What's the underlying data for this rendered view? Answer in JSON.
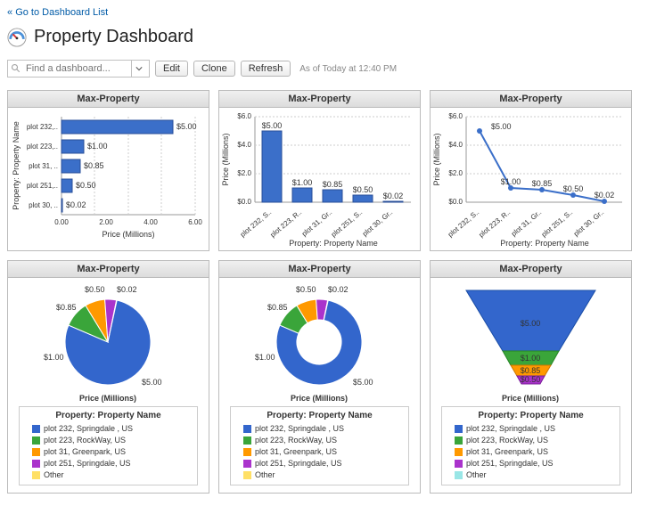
{
  "nav": {
    "back_label": "Go to Dashboard List",
    "back_prefix": "« "
  },
  "page": {
    "title": "Property Dashboard"
  },
  "toolbar": {
    "search_placeholder": "Find a dashboard...",
    "edit": "Edit",
    "clone": "Clone",
    "refresh": "Refresh",
    "timestamp": "As of Today at 12:40 PM"
  },
  "panels": {
    "title": "Max-Property",
    "xlabel_price": "Price (Millions)",
    "xlabel_prop": "Property: Property Name",
    "legend_subtitle": "Property: Property Name"
  },
  "legend": {
    "items": [
      {
        "label": "plot 232, Springdale , US",
        "color": "#3366cc"
      },
      {
        "label": "plot 223, RockWay, US",
        "color": "#3aa53a"
      },
      {
        "label": "plot 31, Greenpark, US",
        "color": "#ff9900"
      },
      {
        "label": "plot 251, Springdale, US",
        "color": "#aa33cc"
      },
      {
        "label": "Other",
        "color": "#ffe066"
      }
    ]
  },
  "funnel_legend": {
    "items": [
      {
        "label": "plot 232, Springdale , US",
        "color": "#3366cc"
      },
      {
        "label": "plot 223, RockWay, US",
        "color": "#3aa53a"
      },
      {
        "label": "plot 31, Greenpark, US",
        "color": "#ff9900"
      },
      {
        "label": "plot 251, Springdale, US",
        "color": "#aa33cc"
      },
      {
        "label": "Other",
        "color": "#99e6e6"
      }
    ]
  },
  "chart_data": [
    {
      "type": "bar",
      "orientation": "horizontal",
      "title": "Max-Property",
      "xlabel": "Price (Millions)",
      "ylabel": "Property: Property Name",
      "categories": [
        "plot 232,..",
        "plot 223,..",
        "plot 31, ..",
        "plot 251,..",
        "plot 30, .."
      ],
      "values": [
        5.0,
        1.0,
        0.85,
        0.5,
        0.02
      ],
      "value_labels": [
        "$5.00",
        "$1.00",
        "$0.85",
        "$0.50",
        "$0.02"
      ],
      "xlim": [
        0.0,
        6.0
      ],
      "xticks": [
        0.0,
        2.0,
        4.0,
        6.0
      ]
    },
    {
      "type": "bar",
      "orientation": "vertical",
      "title": "Max-Property",
      "xlabel": "Property: Property Name",
      "ylabel": "Price (Millions)",
      "categories": [
        "plot 232, S..",
        "plot 223, R..",
        "plot 31, Gr..",
        "plot 251, S..",
        "plot 30, Gr.."
      ],
      "values": [
        5.0,
        1.0,
        0.85,
        0.5,
        0.02
      ],
      "value_labels": [
        "$5.00",
        "$1.00",
        "$0.85",
        "$0.50",
        "$0.02"
      ],
      "ylim": [
        0.0,
        6.0
      ],
      "yticks": [
        "$0.0",
        "$2.0",
        "$4.0",
        "$6.0"
      ]
    },
    {
      "type": "line",
      "title": "Max-Property",
      "xlabel": "Property: Property Name",
      "ylabel": "Price (Millions)",
      "categories": [
        "plot 232, S..",
        "plot 223, R..",
        "plot 31, Gr..",
        "plot 251, S..",
        "plot 30, Gr.."
      ],
      "values": [
        5.0,
        1.0,
        0.85,
        0.5,
        0.02
      ],
      "value_labels": [
        "$5.00",
        "$1.00",
        "$0.85",
        "$0.50",
        "$0.02"
      ],
      "ylim": [
        0.0,
        6.0
      ],
      "yticks": [
        "$0.0",
        "$2.0",
        "$4.0",
        "$6.0"
      ]
    },
    {
      "type": "pie",
      "title": "Max-Property",
      "slices": [
        {
          "label": "$5.00",
          "value": 5.0,
          "color": "#3366cc"
        },
        {
          "label": "$1.00",
          "value": 1.0,
          "color": "#3aa53a"
        },
        {
          "label": "$0.85",
          "value": 0.85,
          "color": "#ff9900"
        },
        {
          "label": "$0.50",
          "value": 0.5,
          "color": "#aa33cc"
        },
        {
          "label": "$0.02",
          "value": 0.02,
          "color": "#ffe066"
        }
      ]
    },
    {
      "type": "pie",
      "donut": true,
      "title": "Max-Property",
      "slices": [
        {
          "label": "$5.00",
          "value": 5.0,
          "color": "#3366cc"
        },
        {
          "label": "$1.00",
          "value": 1.0,
          "color": "#3aa53a"
        },
        {
          "label": "$0.85",
          "value": 0.85,
          "color": "#ff9900"
        },
        {
          "label": "$0.50",
          "value": 0.5,
          "color": "#aa33cc"
        },
        {
          "label": "$0.02",
          "value": 0.02,
          "color": "#ffe066"
        }
      ]
    },
    {
      "type": "funnel",
      "title": "Max-Property",
      "stages": [
        {
          "label": "$5.00",
          "value": 5.0,
          "color": "#3366cc"
        },
        {
          "label": "$1.00",
          "value": 1.0,
          "color": "#3aa53a"
        },
        {
          "label": "$0.85",
          "value": 0.85,
          "color": "#ff9900"
        },
        {
          "label": "$0.50",
          "value": 0.5,
          "color": "#aa33cc"
        }
      ]
    }
  ]
}
